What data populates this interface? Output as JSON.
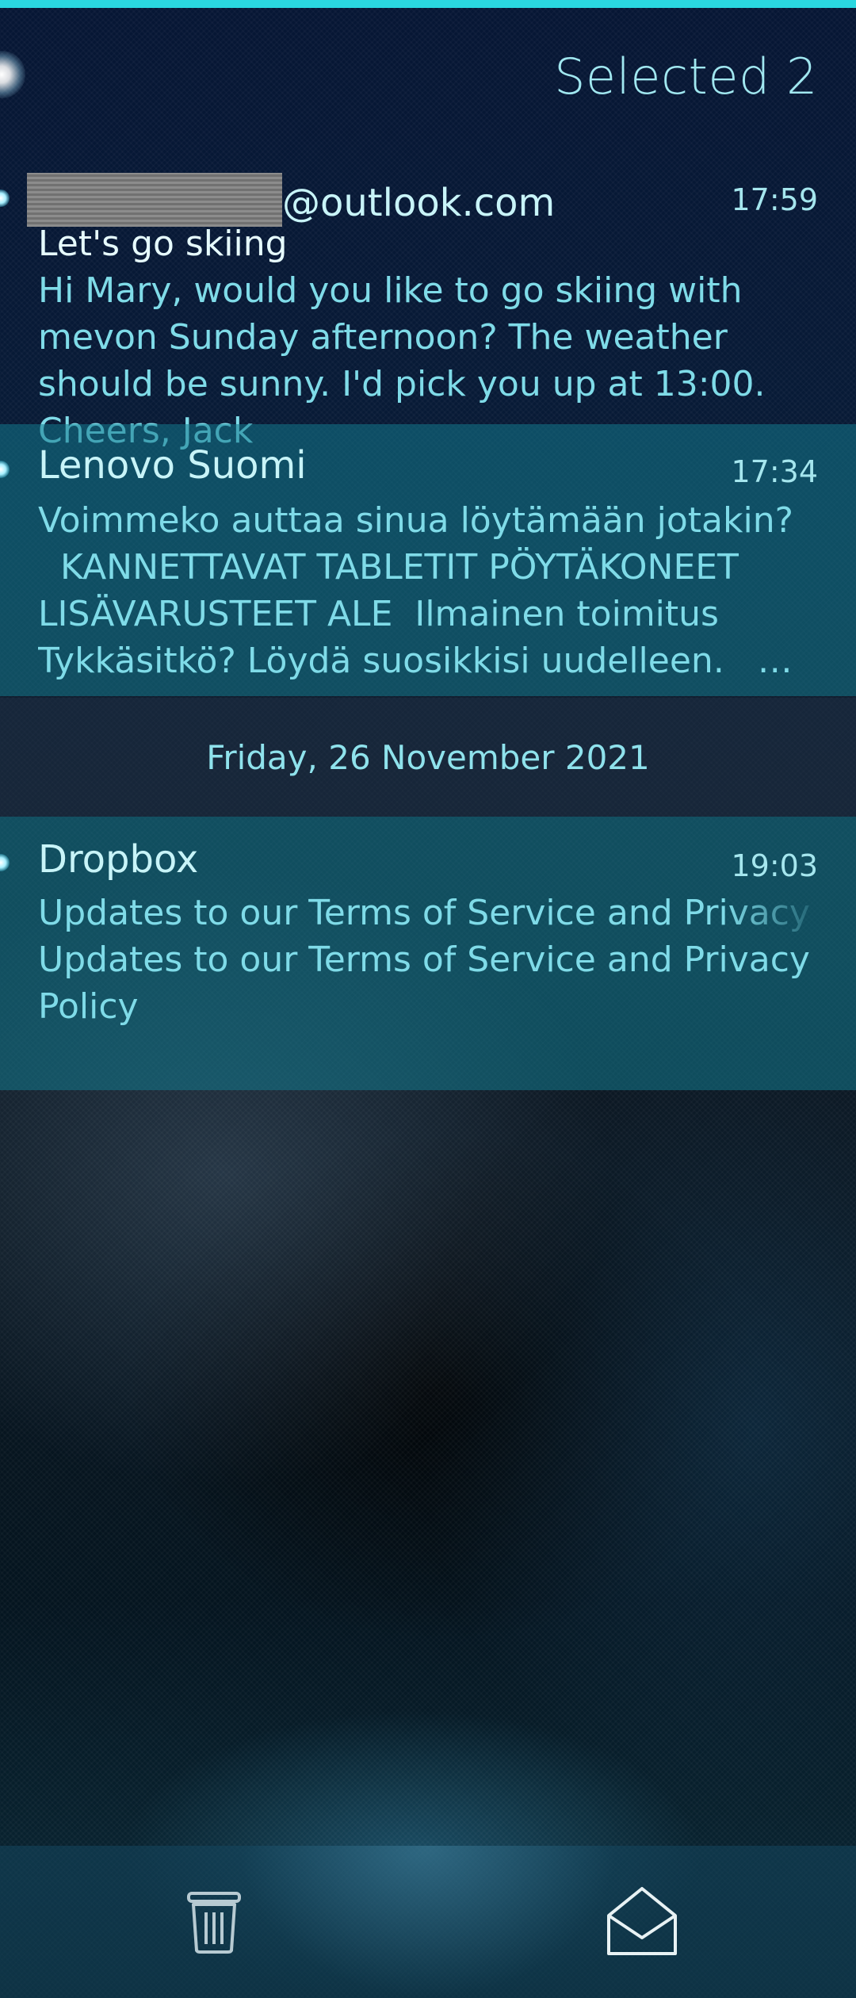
{
  "header": {
    "title": "Selected 2"
  },
  "messages": [
    {
      "sender_visible": "@outlook.com",
      "time": "17:59",
      "subject": "Let's go skiing",
      "preview": "Hi Mary, would you like to go skiing with mevon Sunday afternoon? The weather should be sunny. I'd pick you up at 13:00. Cheers, Jack",
      "selected": false,
      "unread": true
    },
    {
      "sender": "Lenovo Suomi",
      "time": "17:34",
      "preview": "Voimmeko auttaa sinua löytämään jotakin?\n  KANNETTAVAT TABLETIT PÖYTÄKONEET LISÄVARUSTEET ALE  Ilmainen toimitus Tykkäsitkö? Löydä suosikkisi uudelleen.   Yog…",
      "selected": true,
      "unread": true
    },
    {
      "sender": "Dropbox",
      "time": "19:03",
      "subject": "Updates to our Terms of Service and Privacy Policy",
      "preview": "Updates to our Terms of Service and Privacy Policy",
      "selected": true,
      "unread": true
    }
  ],
  "section": {
    "date": "Friday, 26 November 2021"
  },
  "toolbar": {
    "delete_icon": "trash-icon",
    "mark_read_icon": "open-envelope-icon"
  },
  "colors": {
    "accent": "#2ad7e0",
    "text_primary": "#c8f4f8",
    "text_secondary": "#7fdbe8",
    "selected_bg": "#12788c"
  }
}
